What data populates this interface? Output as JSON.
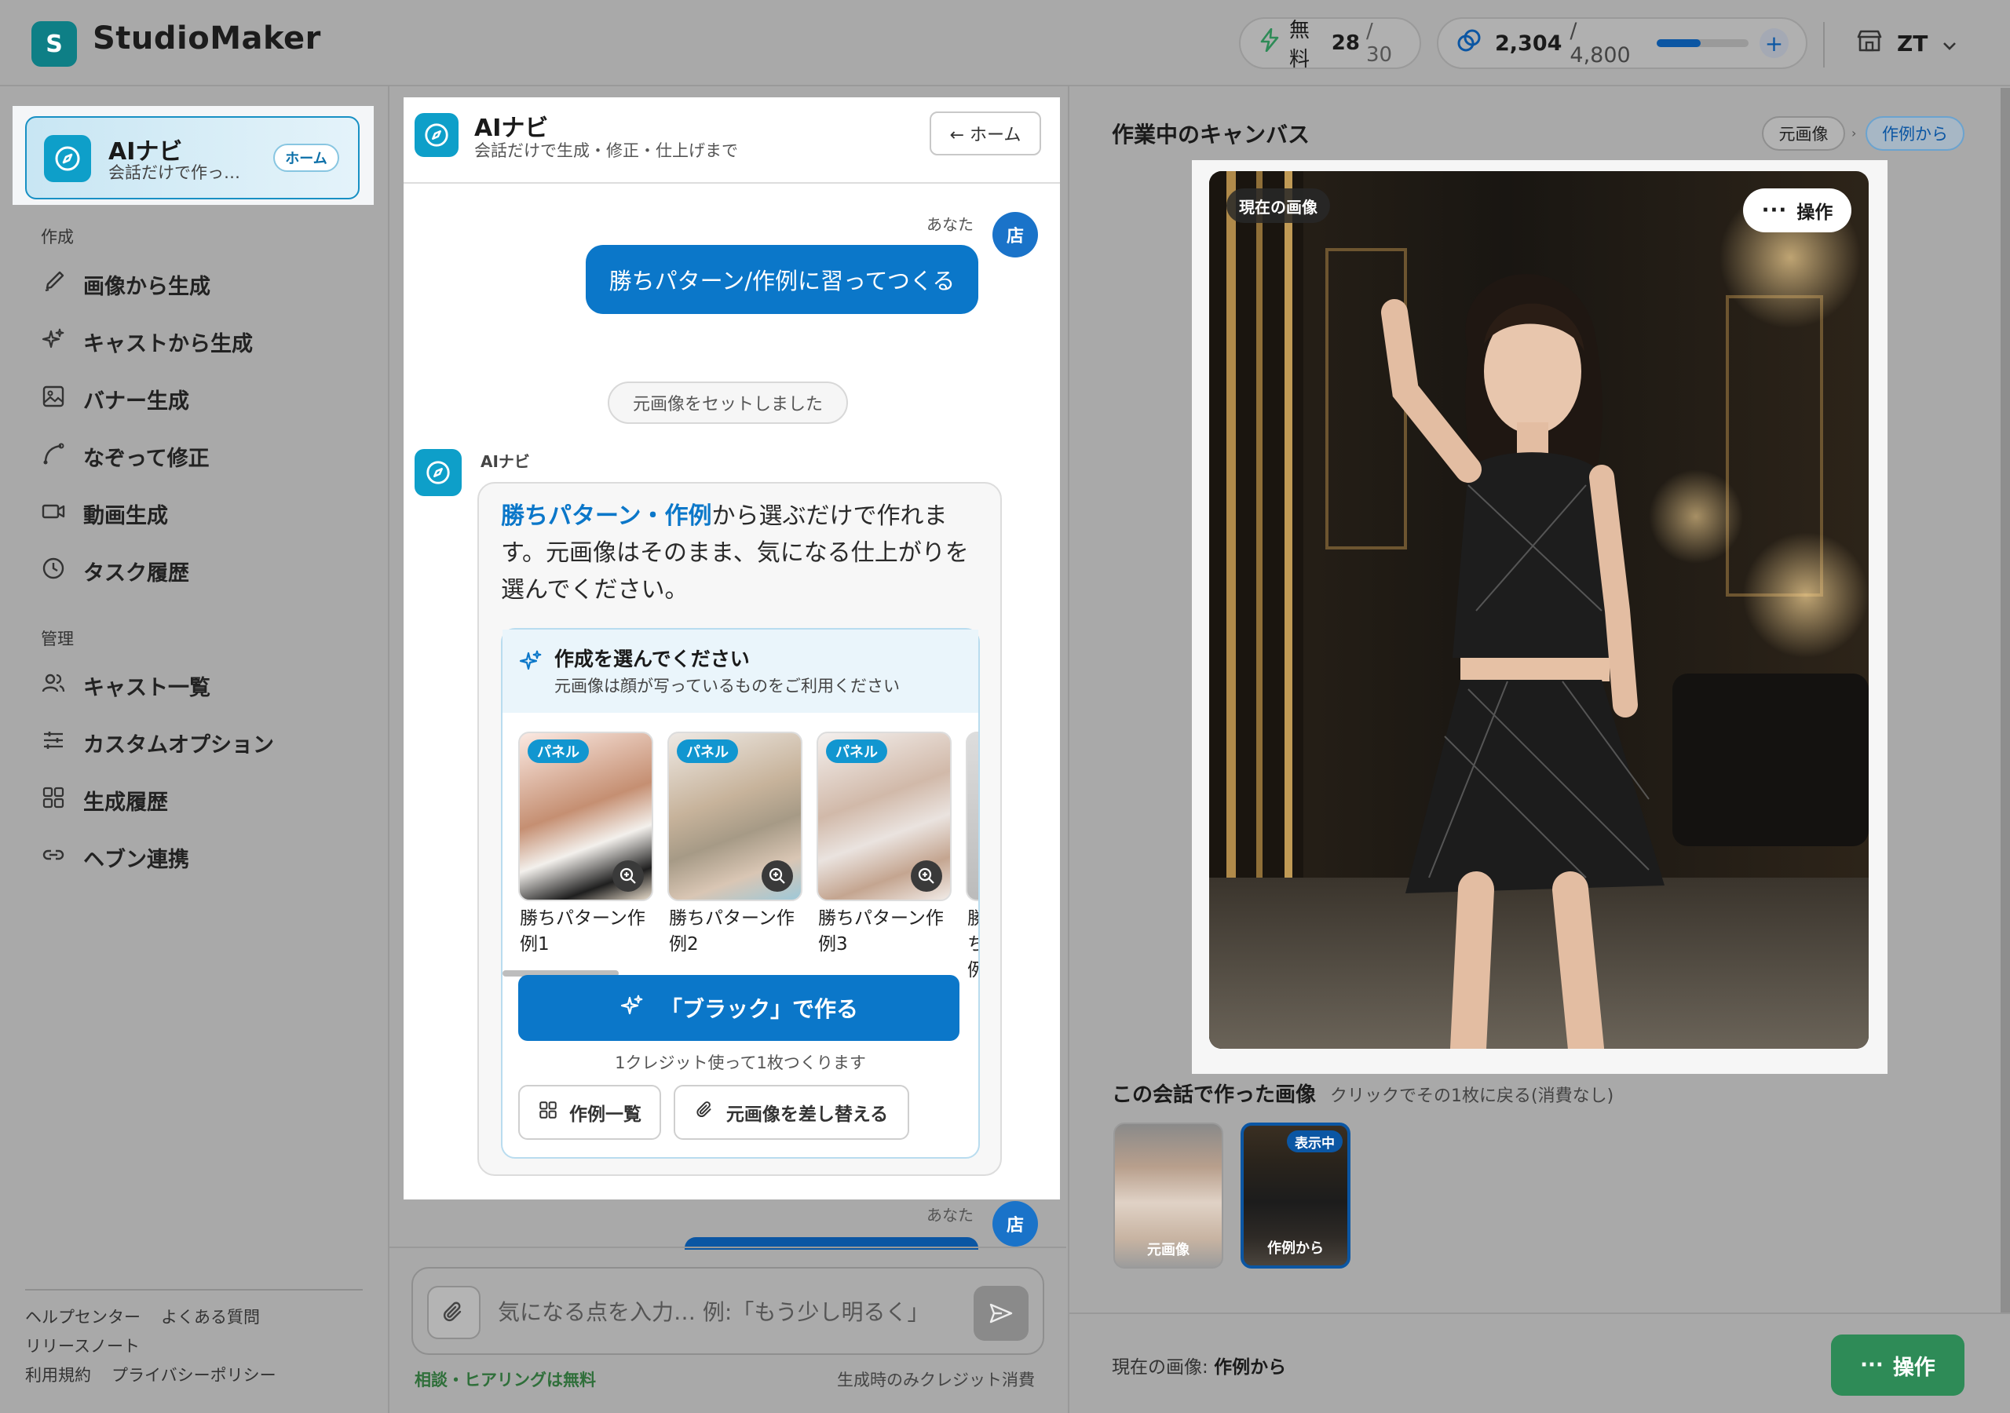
{
  "app": {
    "logo_letter": "S",
    "name": "StudioMaker"
  },
  "topbar": {
    "free_label": "無料",
    "free_used": "28",
    "free_total": "/ 30",
    "credits": "2,304",
    "credits_total": "/ 4,800",
    "credits_fraction": 0.48,
    "plus": "+",
    "user_initials": "ZT"
  },
  "sidebar": {
    "active": {
      "title": "AIナビ",
      "subtitle": "会話だけで作っ…",
      "chip": "ホーム"
    },
    "section_create": "作成",
    "create_items": [
      {
        "label": "画像から生成",
        "icon": "brush-icon"
      },
      {
        "label": "キャストから生成",
        "icon": "sparkle-icon"
      },
      {
        "label": "バナー生成",
        "icon": "image-icon"
      },
      {
        "label": "なぞって修正",
        "icon": "trace-icon"
      },
      {
        "label": "動画生成",
        "icon": "video-icon"
      },
      {
        "label": "タスク履歴",
        "icon": "clock-icon"
      }
    ],
    "section_manage": "管理",
    "manage_items": [
      {
        "label": "キャスト一覧",
        "icon": "users-icon"
      },
      {
        "label": "カスタムオプション",
        "icon": "sliders-icon"
      },
      {
        "label": "生成履歴",
        "icon": "grid-icon"
      },
      {
        "label": "ヘブン連携",
        "icon": "link-icon"
      }
    ],
    "footer": {
      "help": "ヘルプセンター",
      "faq": "よくある質問",
      "release": "リリースノート",
      "terms": "利用規約",
      "privacy": "プライバシーポリシー"
    }
  },
  "chat": {
    "title": "AIナビ",
    "subtitle": "会話だけで生成・修正・仕上げまで",
    "home_button": "← ホーム",
    "you_label": "あなた",
    "avatar_text": "店",
    "user_message": "勝ちパターン/作例に習ってつくる",
    "system_note": "元画像をセットしました",
    "ai_label": "AIナビ",
    "ai_text_highlight": "勝ちパターン・作例",
    "ai_text_rest": "から選ぶだけで作れます。元画像はそのまま、気になる仕上がりを選んでください。",
    "select_title": "作成を選んでください",
    "select_subtitle": "元画像は顔が写っているものをご利用ください",
    "examples": [
      {
        "badge": "パネル",
        "label": "勝ちパターン作例1"
      },
      {
        "badge": "パネル",
        "label": "勝ちパターン作例2"
      },
      {
        "badge": "パネル",
        "label": "勝ちパターン作例3"
      },
      {
        "badge": "",
        "label": "勝ち例"
      }
    ],
    "make_button": "「ブラック」で作る",
    "credit_note": "1クレジット使って1枚つくります",
    "list_button": "作例一覧",
    "replace_button": "元画像を差し替える",
    "input_placeholder": "気になる点を入力… 例:「もう少し明るく」",
    "free_note": "相談・ヒアリングは無料",
    "credit_only_note": "生成時のみクレジット消費"
  },
  "canvas": {
    "title": "作業中のキャンバス",
    "crumb_original": "元画像",
    "crumb_example": "作例から",
    "current_badge": "現在の画像",
    "op_button": "操作",
    "history_title": "この会話で作った画像",
    "history_subtitle": "クリックでその1枚に戻る(消費なし)",
    "history": [
      {
        "label": "元画像",
        "badge": ""
      },
      {
        "label": "作例から",
        "badge": "表示中"
      }
    ],
    "current_prefix": "現在の画像:",
    "current_value": "作例から",
    "green_op": "操作"
  },
  "colors": {
    "accent": "#0b77c9",
    "teal": "#0e9fc9",
    "green": "#2e8b57"
  }
}
